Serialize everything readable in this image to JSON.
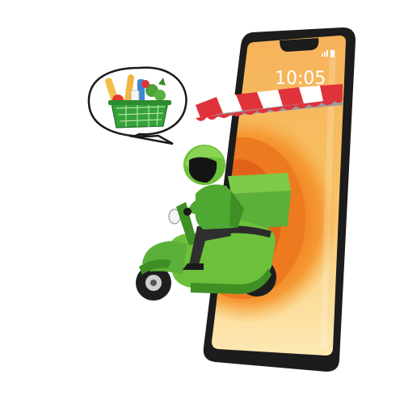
{
  "illustration": {
    "subject": "delivery-scooter-leaving-smartphone",
    "phone": {
      "clock": "10:05",
      "status_icons": [
        "signal-icon",
        "battery-icon"
      ]
    },
    "speech_bubble": {
      "content": "grocery-basket-icon"
    },
    "colors": {
      "phone_body": "#1c1c1c",
      "screen_light": "#fde8b0",
      "screen_mid": "#f7a93a",
      "screen_orange": "#f08a1c",
      "screen_deep": "#e2661a",
      "awning_red": "#e0323a",
      "scooter_green": "#6cc03a",
      "scooter_dark_green": "#3f8f25",
      "rider_green": "#4ea832",
      "basket_green": "#35a23a"
    }
  }
}
